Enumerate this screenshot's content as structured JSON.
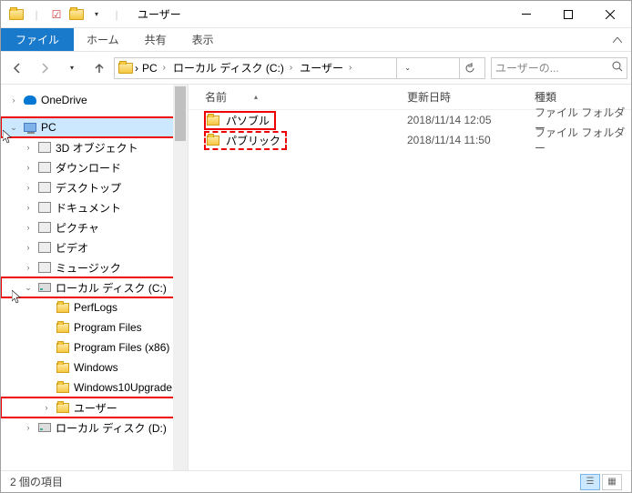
{
  "window": {
    "title": "ユーザー",
    "qat_dropdown": "▾"
  },
  "tabs": {
    "file": "ファイル",
    "home": "ホーム",
    "share": "共有",
    "view": "表示"
  },
  "nav": {
    "breadcrumb": [
      "PC",
      "ローカル ディスク (C:)",
      "ユーザー"
    ],
    "search_placeholder": "ユーザーの..."
  },
  "tree": {
    "onedrive": "OneDrive",
    "pc": "PC",
    "pc_children": [
      {
        "label": "3D オブジェクト",
        "icon": "obj"
      },
      {
        "label": "ダウンロード",
        "icon": "dl"
      },
      {
        "label": "デスクトップ",
        "icon": "desk"
      },
      {
        "label": "ドキュメント",
        "icon": "doc"
      },
      {
        "label": "ピクチャ",
        "icon": "pic"
      },
      {
        "label": "ビデオ",
        "icon": "video"
      },
      {
        "label": "ミュージック",
        "icon": "music"
      }
    ],
    "drive_c": "ローカル ディスク (C:)",
    "drive_c_children": [
      "PerfLogs",
      "Program Files",
      "Program Files (x86)",
      "Windows",
      "Windows10Upgrade",
      "ユーザー"
    ],
    "drive_d": "ローカル ディスク (D:)"
  },
  "columns": {
    "name": "名前",
    "date": "更新日時",
    "type": "種類"
  },
  "rows": [
    {
      "name": "パソブル",
      "date": "2018/11/14 12:05",
      "type": "ファイル フォルダー",
      "hl": "solid"
    },
    {
      "name": "パブリック",
      "date": "2018/11/14 11:50",
      "type": "ファイル フォルダー",
      "hl": "dash"
    }
  ],
  "status": {
    "count": "2 個の項目"
  }
}
